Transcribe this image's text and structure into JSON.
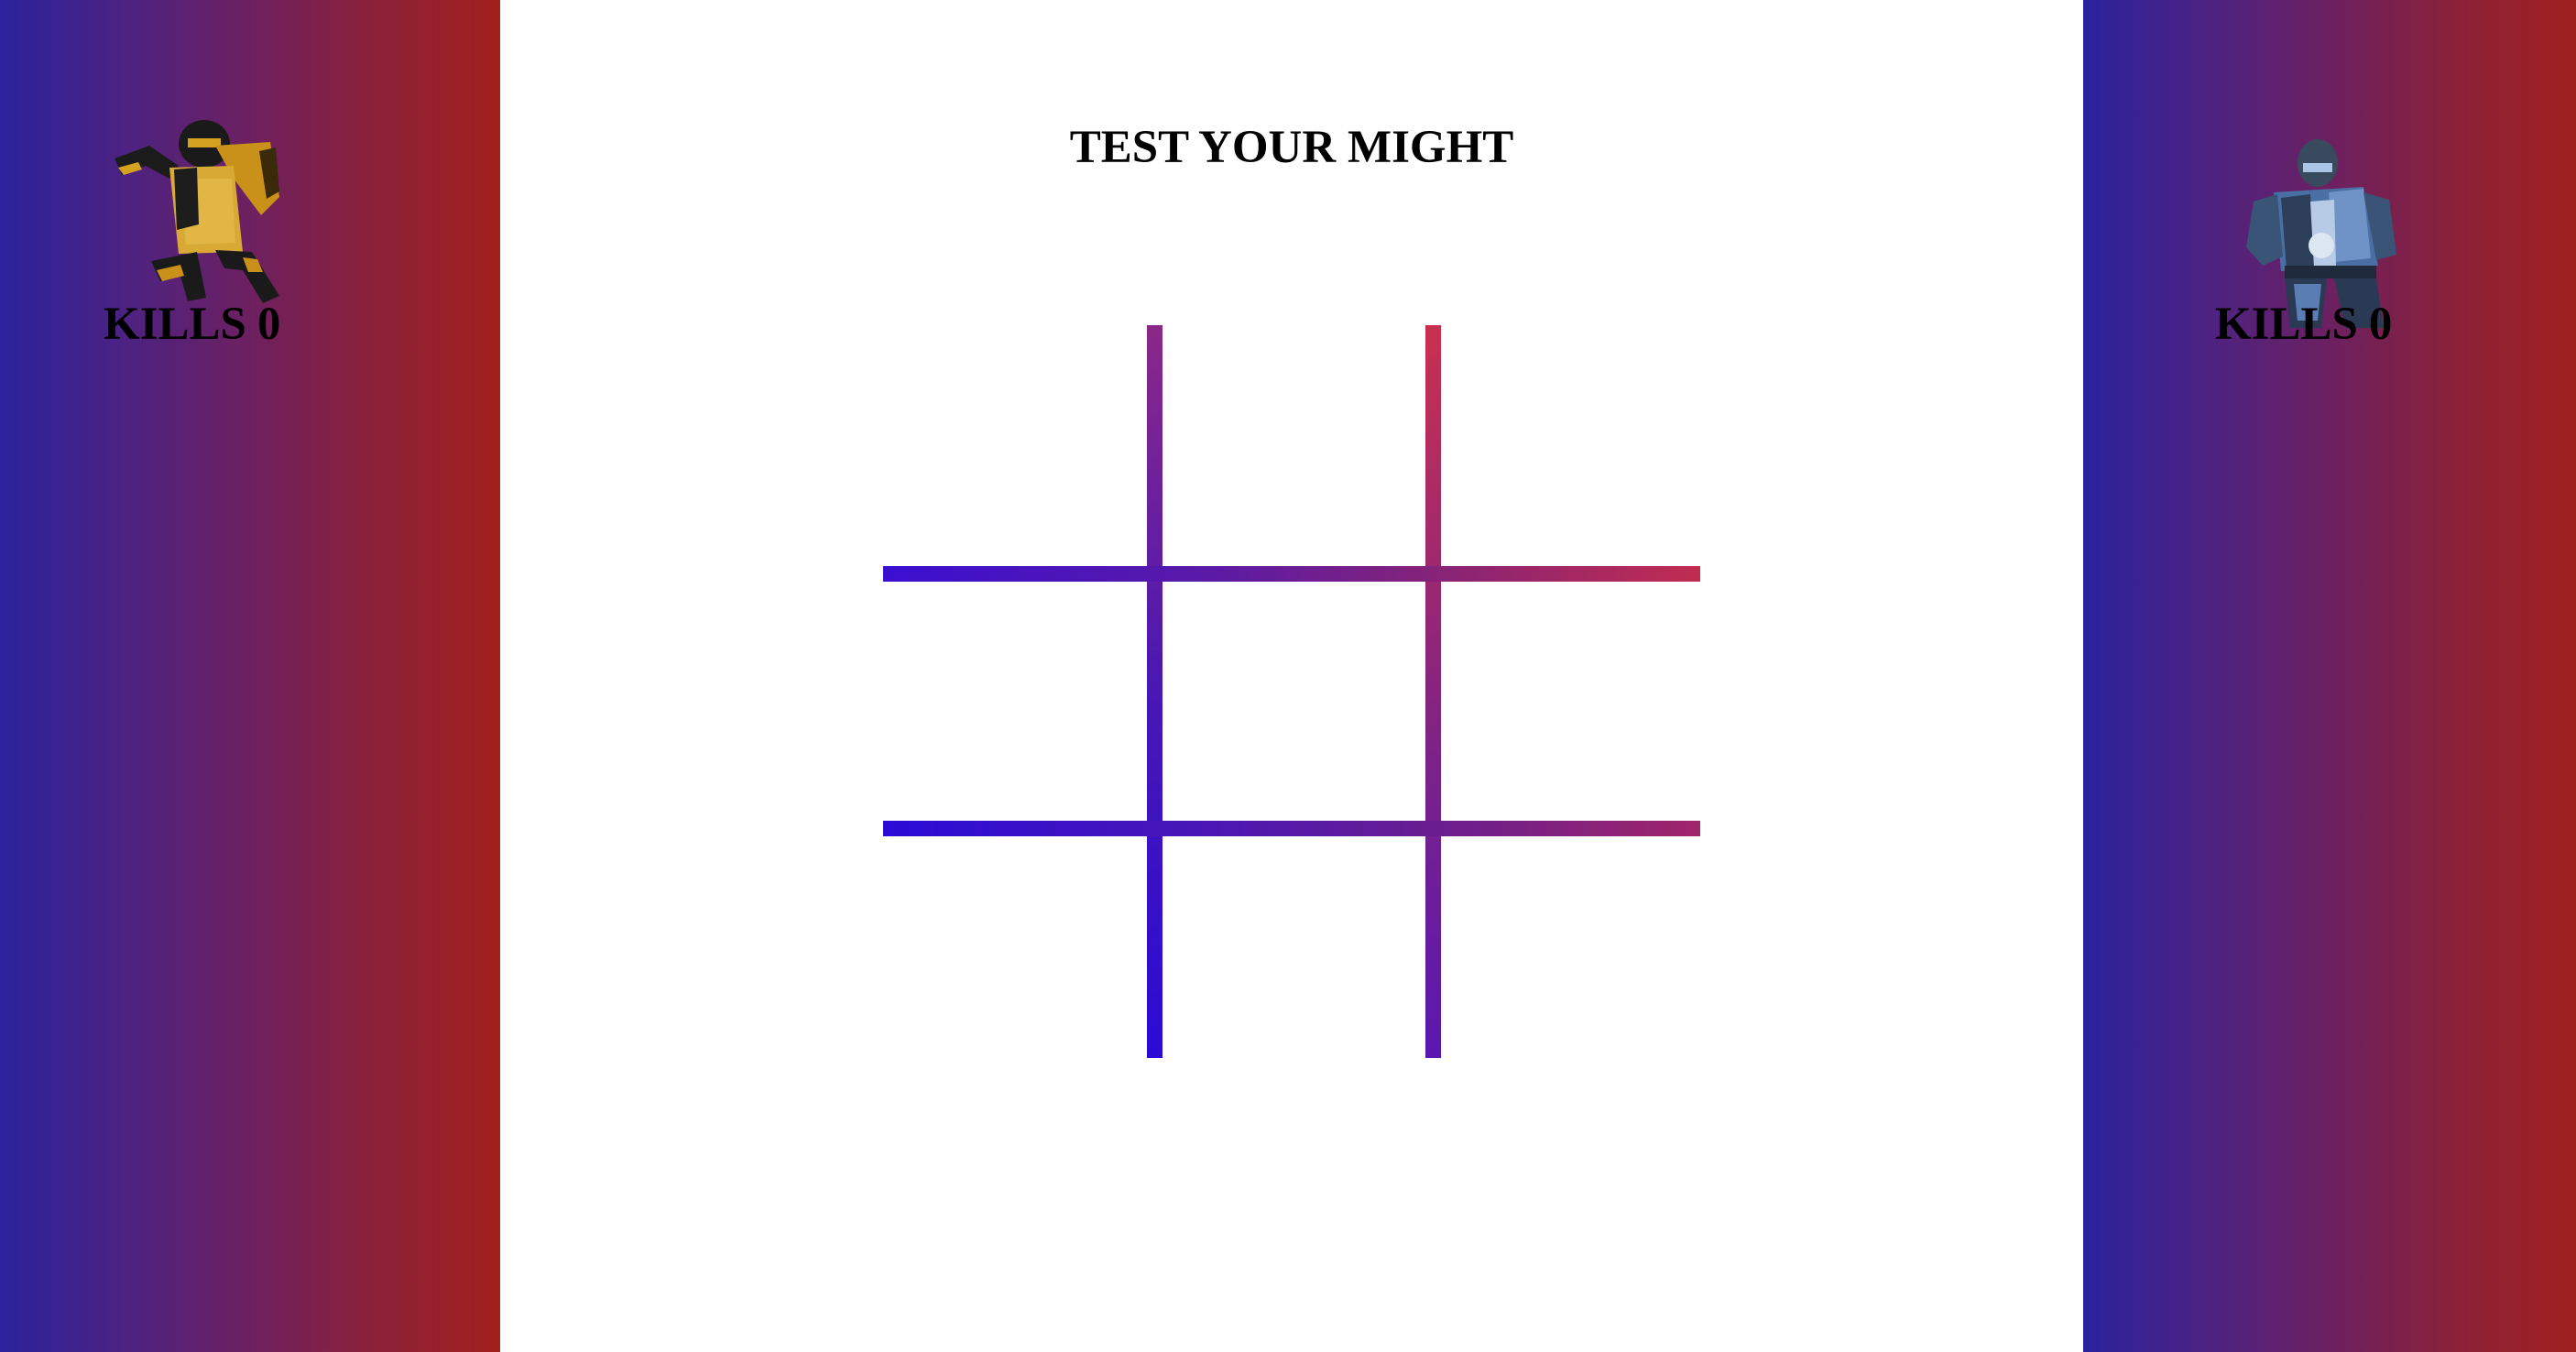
{
  "title": "TEST YOUR MIGHT",
  "players": [
    {
      "name_icon": "scorpion-fighter-icon",
      "kills_label": "KILLS",
      "kills": "0",
      "accent": "#d4a21e"
    },
    {
      "name_icon": "sub-zero-fighter-icon",
      "kills_label": "KILLS",
      "kills": "0",
      "accent": "#4f83c6"
    }
  ],
  "panel_gradient": [
    "#2b229c",
    "#a1201d"
  ],
  "board": {
    "rows": 3,
    "cols": 3,
    "cells": [
      "",
      "",
      "",
      "",
      "",
      "",
      "",
      "",
      ""
    ],
    "line_colors": [
      "#2a0bd6",
      "#c9304f"
    ]
  }
}
